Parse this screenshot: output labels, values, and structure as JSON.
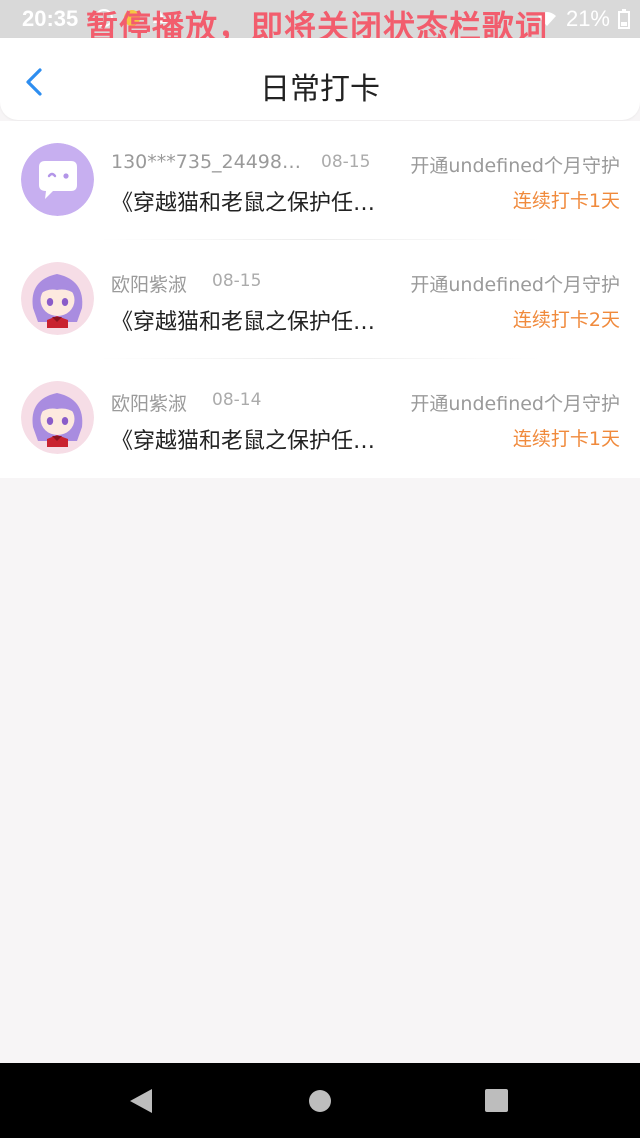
{
  "status_bar": {
    "time": "20:35",
    "battery": "21%",
    "lyric_overlay": "暂停播放，即将关闭状态栏歌词"
  },
  "header": {
    "title": "日常打卡",
    "back_icon": "chevron-left-icon"
  },
  "colors": {
    "accent_back": "#2e8ef0",
    "streak_orange": "#f08a3c",
    "lyric_red": "#f25d6d"
  },
  "items": [
    {
      "name": "130***735_24498…",
      "date": "08-15",
      "description": "《穿越猫和老鼠之保护任…",
      "guard_text": "开通undefined个月守护",
      "streak_text": "连续打卡1天",
      "avatar": "chat-bubble-avatar"
    },
    {
      "name": "欧阳紫淑",
      "date": "08-15",
      "description": "《穿越猫和老鼠之保护任…",
      "guard_text": "开通undefined个月守护",
      "streak_text": "连续打卡2天",
      "avatar": "anime-girl-avatar"
    },
    {
      "name": "欧阳紫淑",
      "date": "08-14",
      "description": "《穿越猫和老鼠之保护任…",
      "guard_text": "开通undefined个月守护",
      "streak_text": "连续打卡1天",
      "avatar": "anime-girl-avatar"
    }
  ]
}
